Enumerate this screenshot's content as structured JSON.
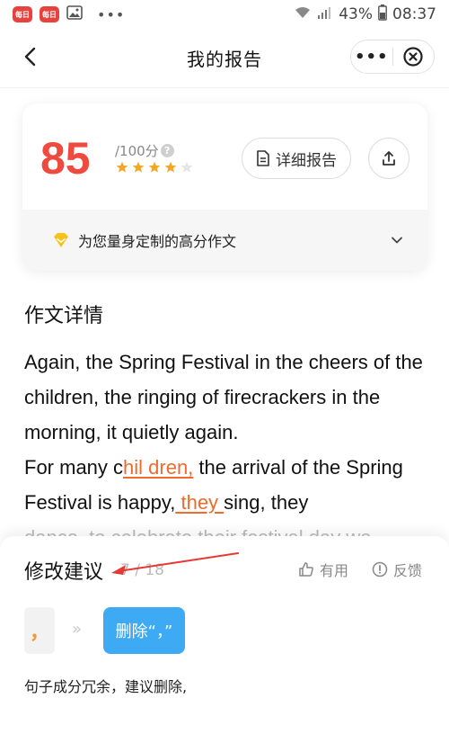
{
  "status_bar": {
    "app_badge_1": "每日",
    "app_badge_2": "每日",
    "dots": "•••",
    "battery": "43%",
    "time": "08:37"
  },
  "nav": {
    "title": "我的报告",
    "more": "•••"
  },
  "score": {
    "value": "85",
    "total": "/100分",
    "help": "?",
    "stars_filled": 4,
    "stars_total": 5,
    "detail_button": "详细报告"
  },
  "promo": {
    "text": "为您量身定制的高分作文"
  },
  "essay": {
    "title": "作文详情",
    "line_1": "Again, the Spring Festival in the cheers of the children, the ringing of firecrackers in the morning, it quietly again.",
    "line_2_a": "For many c",
    "line_2_err": "hil dren,",
    "line_2_b": " the arrival of the Spring Festival is happy,",
    "line_2_c": " t",
    "line_2_err2": "hey ",
    "line_2_d": "sing, they",
    "line_3_faded": "dance, to celebrate their festival day we"
  },
  "suggestion": {
    "title": "修改建议",
    "counter": "7 / 18",
    "useful": "有用",
    "feedback": "反馈",
    "original_token": "，",
    "arrows": "»",
    "suggest_button": "删除“，”",
    "explanation": "句子成分冗余，建议删除,"
  },
  "colors": {
    "score_red": "#ee4a3d",
    "error_orange": "#ee6a2d",
    "suggest_blue": "#3daaf3",
    "star_orange": "#f5a623"
  }
}
